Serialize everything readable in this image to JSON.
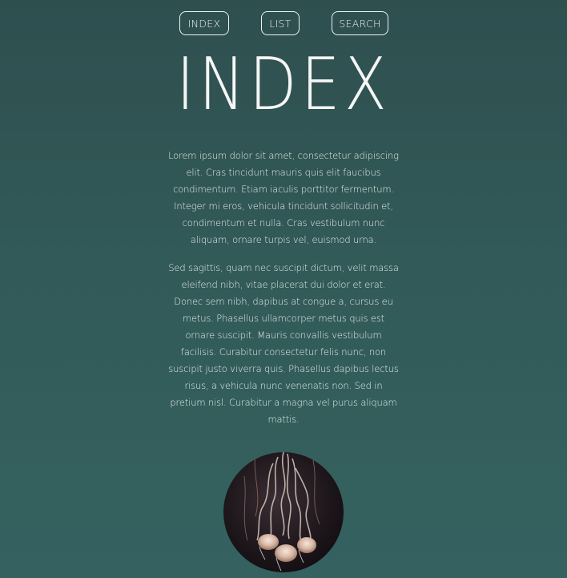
{
  "nav": {
    "items": [
      {
        "label": "INDEX"
      },
      {
        "label": "LIST"
      },
      {
        "label": "SEARCH"
      }
    ]
  },
  "page": {
    "title": "INDEX"
  },
  "content": {
    "paragraphs": [
      "Lorem ipsum dolor sit amet, consectetur adipiscing elit. Cras tincidunt mauris quis elit faucibus condimentum. Etiam iaculis porttitor fermentum. Integer mi eros, vehicula tincidunt sollicitudin et, condimentum et nulla. Cras vestibulum nunc aliquam, ornare turpis vel, euismod urna.",
      "Sed sagittis, quam nec suscipit dictum, velit massa eleifend nibh, vitae placerat dui dolor et erat. Donec sem nibh, dapibus at congue a, cursus eu metus. Phasellus ullamcorper metus quis est ornare suscipit. Mauris convallis vestibulum facilisis. Curabitur consectetur felis nunc, non suscipit justo viverra quis. Phasellus dapibus lectus risus, a vehicula nunc venenatis non. Sed in pretium nisl. Curabitur a magna vel purus aliquam mattis."
    ]
  },
  "image": {
    "subject": "jellyfish-photo"
  },
  "colors": {
    "background_top": "#2f4f4f",
    "background_bottom": "#356260",
    "text": "#eef2f1"
  }
}
